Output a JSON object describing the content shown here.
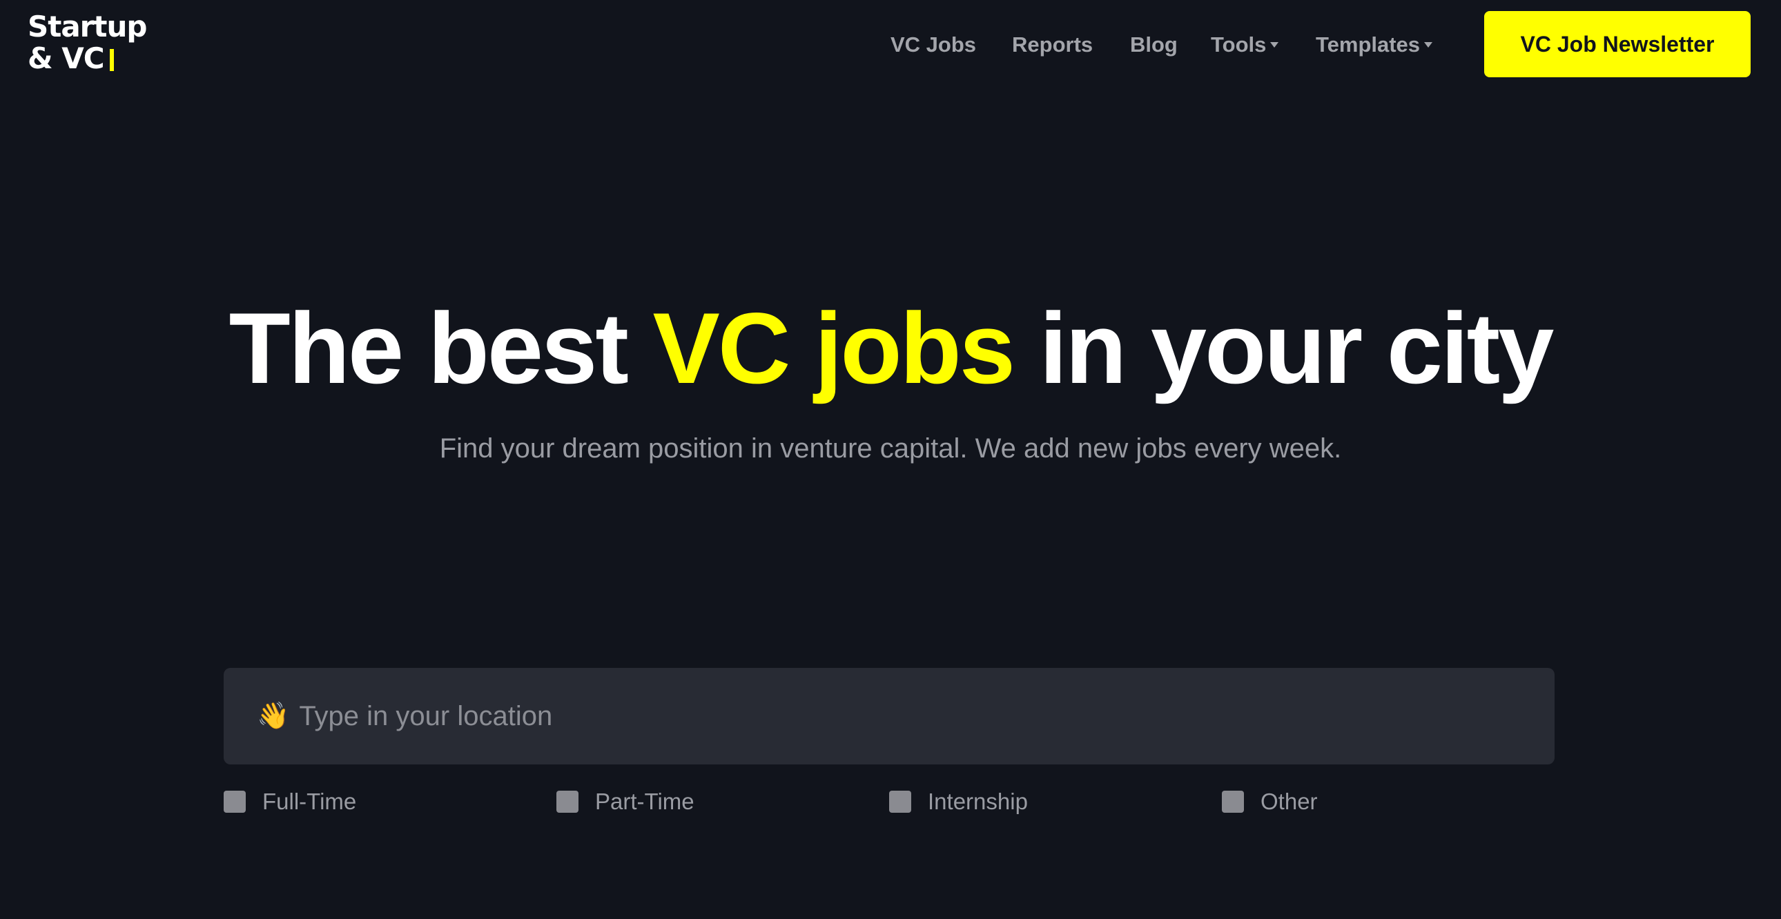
{
  "brand": {
    "logo_line1": "Startup",
    "logo_line2": "& VC",
    "accent_color": "#ffff00",
    "background_color": "#11141c"
  },
  "nav": {
    "items": [
      {
        "label": "VC Jobs"
      },
      {
        "label": "Reports"
      },
      {
        "label": "Blog"
      },
      {
        "label": "Tools",
        "dropdown": true
      },
      {
        "label": "Templates",
        "dropdown": true
      }
    ],
    "cta_label": "VC Job Newsletter"
  },
  "hero": {
    "title_part1": "The best ",
    "title_accent": "VC jobs",
    "title_part2": " in your city",
    "subtitle": "Find your dream position in venture capital. We add new jobs every week."
  },
  "search": {
    "icon": "waving-hand-icon",
    "placeholder": "Type in your location",
    "value": ""
  },
  "filters": [
    {
      "label": "Full-Time",
      "checked": false
    },
    {
      "label": "Part-Time",
      "checked": false
    },
    {
      "label": "Internship",
      "checked": false
    },
    {
      "label": "Other",
      "checked": false
    }
  ]
}
